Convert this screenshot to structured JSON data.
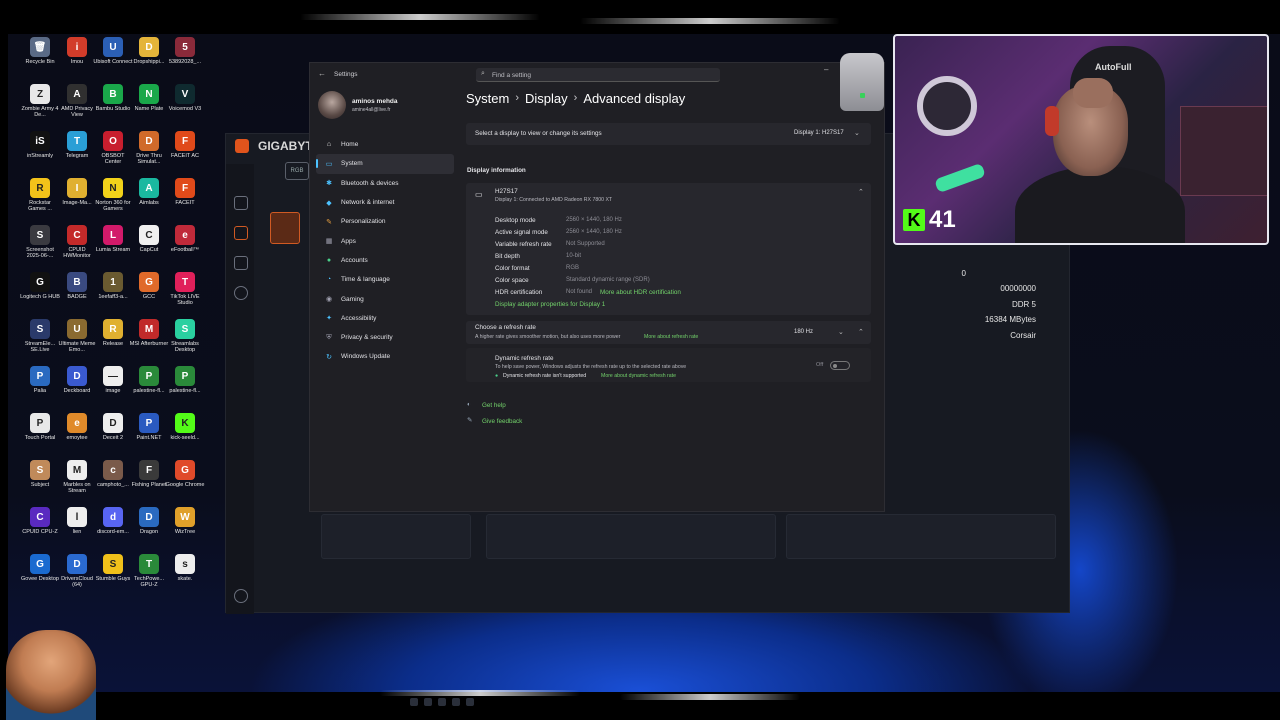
{
  "desktop": {
    "icons": [
      {
        "label": "Recycle Bin",
        "color": "#5a6a86",
        "glyph": "🗑"
      },
      {
        "label": "Imou",
        "color": "#d23c2a",
        "glyph": "i"
      },
      {
        "label": "Ubisoft Connect",
        "color": "#2b5fb5",
        "glyph": "U"
      },
      {
        "label": "Dropshippi...",
        "color": "#e4b43a",
        "glyph": "D"
      },
      {
        "label": "53892028_...",
        "color": "#8a2a3a",
        "glyph": "5"
      },
      {
        "label": "Zombie Army 4 De...",
        "color": "#e8e8e8",
        "glyph": "Z"
      },
      {
        "label": "AMD Privacy View",
        "color": "#303030",
        "glyph": "A"
      },
      {
        "label": "Bambu Studio",
        "color": "#1aa84a",
        "glyph": "B"
      },
      {
        "label": "Name Plate",
        "color": "#1aa84a",
        "glyph": "N"
      },
      {
        "label": "Voicemod V3",
        "color": "#0f2a2f",
        "glyph": "V"
      },
      {
        "label": "inStreamly",
        "color": "#111",
        "glyph": "iS"
      },
      {
        "label": "Telegram",
        "color": "#2a9fd6",
        "glyph": "T"
      },
      {
        "label": "OBSBOT Center",
        "color": "#c81e2e",
        "glyph": "O"
      },
      {
        "label": "Drive Thru Simulat...",
        "color": "#d06a2a",
        "glyph": "D"
      },
      {
        "label": "FACEIT AC",
        "color": "#e04a1a",
        "glyph": "F"
      },
      {
        "label": "Rockstar Games ...",
        "color": "#f2c21a",
        "glyph": "R"
      },
      {
        "label": "Image-Ma...",
        "color": "#e0b030",
        "glyph": "I"
      },
      {
        "label": "Norton 360 for Gamers",
        "color": "#f2d21a",
        "glyph": "N"
      },
      {
        "label": "Aimlabs",
        "color": "#1ab8a0",
        "glyph": "A"
      },
      {
        "label": "FACEIT",
        "color": "#e04a1a",
        "glyph": "F"
      },
      {
        "label": "Screenshot 2025-06-...",
        "color": "#3a3a40",
        "glyph": "S"
      },
      {
        "label": "CPUID HWMonitor",
        "color": "#c42a2a",
        "glyph": "C"
      },
      {
        "label": "Lumia Stream",
        "color": "#d21a6a",
        "glyph": "L"
      },
      {
        "label": "CapCut",
        "color": "#f0f0f0",
        "glyph": "C"
      },
      {
        "label": "eFootball™",
        "color": "#c02a3a",
        "glyph": "e"
      },
      {
        "label": "Logitech G HUB",
        "color": "#111",
        "glyph": "G"
      },
      {
        "label": "BADGE",
        "color": "#3a4a80",
        "glyph": "B"
      },
      {
        "label": "1eefaff3-a...",
        "color": "#6a5a30",
        "glyph": "1"
      },
      {
        "label": "GCC",
        "color": "#e06a2a",
        "glyph": "G"
      },
      {
        "label": "TikTok LIVE Studio",
        "color": "#e0205a",
        "glyph": "T"
      },
      {
        "label": "StreamEle... SE.Live",
        "color": "#2a3a6a",
        "glyph": "S"
      },
      {
        "label": "Ultimate Meme Emo...",
        "color": "#8a6a30",
        "glyph": "U"
      },
      {
        "label": "Release",
        "color": "#e0b030",
        "glyph": "R"
      },
      {
        "label": "MSI Afterburner",
        "color": "#c02a2a",
        "glyph": "M"
      },
      {
        "label": "Streamlabs Desktop",
        "color": "#2ad0a0",
        "glyph": "S"
      },
      {
        "label": "Palia",
        "color": "#2a6ac0",
        "glyph": "P"
      },
      {
        "label": "Deckboard",
        "color": "#3a5ad0",
        "glyph": "D"
      },
      {
        "label": "image",
        "color": "#eee",
        "glyph": "—"
      },
      {
        "label": "palestine-fl...",
        "color": "#2a8a3a",
        "glyph": "P"
      },
      {
        "label": "palestine-fl...",
        "color": "#2a8a3a",
        "glyph": "P"
      },
      {
        "label": "Touch Portal",
        "color": "#e8e8e8",
        "glyph": "P"
      },
      {
        "label": "emoytee",
        "color": "#e08a2a",
        "glyph": "e"
      },
      {
        "label": "Deceit 2",
        "color": "#eee",
        "glyph": "D"
      },
      {
        "label": "Paint.NET",
        "color": "#2a5ac0",
        "glyph": "P"
      },
      {
        "label": "kick-seeld...",
        "color": "#53fc18",
        "glyph": "K"
      },
      {
        "label": "Subject",
        "color": "#c08a5a",
        "glyph": "S"
      },
      {
        "label": "Marbles on Stream",
        "color": "#eee",
        "glyph": "M"
      },
      {
        "label": "camphoto_...",
        "color": "#7a5a4a",
        "glyph": "c"
      },
      {
        "label": "Fishing Planet",
        "color": "#3a3a3a",
        "glyph": "F"
      },
      {
        "label": "Google Chrome",
        "color": "#e04a2a",
        "glyph": "G"
      },
      {
        "label": "CPUID CPU-Z",
        "color": "#5a2ac0",
        "glyph": "C"
      },
      {
        "label": "lien",
        "color": "#eee",
        "glyph": "l"
      },
      {
        "label": "discord-em...",
        "color": "#5865f2",
        "glyph": "d"
      },
      {
        "label": "Dragon",
        "color": "#2a6ac0",
        "glyph": "D"
      },
      {
        "label": "WizTree",
        "color": "#e0a02a",
        "glyph": "W"
      },
      {
        "label": "Govee Desktop",
        "color": "#1a6ad0",
        "glyph": "G"
      },
      {
        "label": "DriversCloud (64)",
        "color": "#2a6ad0",
        "glyph": "D"
      },
      {
        "label": "Stumble Guys",
        "color": "#f0c01a",
        "glyph": "S"
      },
      {
        "label": "TechPowe... GPU-Z",
        "color": "#2a8a3a",
        "glyph": "T"
      },
      {
        "label": "skate.",
        "color": "#eee",
        "glyph": "s"
      }
    ]
  },
  "gigabyte": {
    "title": "GIGABYT",
    "rgb_label": "RGB",
    "stats": [
      "0",
      "00000000",
      "DDR 5",
      "16384 MBytes",
      "Corsair"
    ]
  },
  "settings": {
    "window_title": "Settings",
    "search_placeholder": "Find a setting",
    "user": {
      "name": "aminos mehda",
      "email": "amine4all@live.fr"
    },
    "nav": [
      {
        "label": "Home",
        "icon": "⌂",
        "color": "#e0e0e0"
      },
      {
        "label": "System",
        "icon": "▭",
        "color": "#4cc2ff",
        "active": true
      },
      {
        "label": "Bluetooth & devices",
        "icon": "✱",
        "color": "#4cc2ff"
      },
      {
        "label": "Network & internet",
        "icon": "◆",
        "color": "#4cc2ff"
      },
      {
        "label": "Personalization",
        "icon": "✎",
        "color": "#e8a040"
      },
      {
        "label": "Apps",
        "icon": "▦",
        "color": "#a0a0b0"
      },
      {
        "label": "Accounts",
        "icon": "●",
        "color": "#4ad08a"
      },
      {
        "label": "Time & language",
        "icon": "◔",
        "color": "#4cc2ff"
      },
      {
        "label": "Gaming",
        "icon": "◉",
        "color": "#a0a0b0"
      },
      {
        "label": "Accessibility",
        "icon": "✦",
        "color": "#4cc2ff"
      },
      {
        "label": "Privacy & security",
        "icon": "⛨",
        "color": "#a0a0b0"
      },
      {
        "label": "Windows Update",
        "icon": "↻",
        "color": "#4cc2ff"
      }
    ],
    "breadcrumb": [
      "System",
      "Display",
      "Advanced display"
    ],
    "select_display": {
      "label": "Select a display to view or change its settings",
      "value": "Display 1: H27S17"
    },
    "section_title": "Display information",
    "monitor": {
      "name": "H27S17",
      "subtitle": "Display 1: Connected to AMD Radeon RX 7800 XT"
    },
    "info": [
      {
        "key": "Desktop mode",
        "value": "2560 × 1440, 180 Hz"
      },
      {
        "key": "Active signal mode",
        "value": "2560 × 1440, 180 Hz"
      },
      {
        "key": "Variable refresh rate",
        "value": "Not Supported"
      },
      {
        "key": "Bit depth",
        "value": "10-bit"
      },
      {
        "key": "Color format",
        "value": "RGB"
      },
      {
        "key": "Color space",
        "value": "Standard dynamic range (SDR)"
      },
      {
        "key": "HDR certification",
        "value": "Not found"
      }
    ],
    "hdr_link": "More about HDR certification",
    "adapter_link": "Display adapter properties for Display 1",
    "refresh": {
      "title": "Choose a refresh rate",
      "desc": "A higher rate gives smoother motion, but also uses more power",
      "link": "More about refresh rate",
      "value": "180 Hz"
    },
    "dynamic": {
      "title": "Dynamic refresh rate",
      "desc": "To help save power, Windows adjusts the refresh rate up to the selected rate above",
      "note": "Dynamic refresh rate isn't supported",
      "link": "More about dynamic refresh rate",
      "toggle": "Off"
    },
    "help": {
      "get_help": "Get help",
      "feedback": "Give feedback"
    }
  },
  "stream": {
    "kick_count": "41",
    "chair_brand": "AutoFull",
    "kick_color": "#53fc18"
  }
}
